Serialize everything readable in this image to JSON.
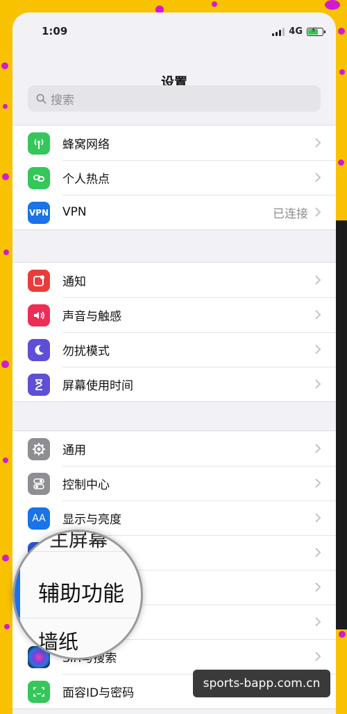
{
  "status_bar": {
    "time": "1:09",
    "network": "4G"
  },
  "header": {
    "title": "设置"
  },
  "search": {
    "placeholder": "搜索"
  },
  "group1": [
    {
      "label": "蜂窝网络",
      "icon": "antenna-icon",
      "color": "#34c759"
    },
    {
      "label": "个人热点",
      "icon": "hotspot-link-icon",
      "color": "#34c759"
    },
    {
      "label": "VPN",
      "icon_text": "VPN",
      "icon": "vpn-icon",
      "color": "#1a73e8",
      "value": "已连接"
    }
  ],
  "group2": [
    {
      "label": "通知",
      "icon": "notification-icon",
      "color": "#ec3b3b"
    },
    {
      "label": "声音与触感",
      "icon": "speaker-icon",
      "color": "#ec2e56"
    },
    {
      "label": "勿扰模式",
      "icon": "moon-icon",
      "color": "#5e4fd6"
    },
    {
      "label": "屏幕使用时间",
      "icon": "hourglass-icon",
      "color": "#5e4fd6"
    }
  ],
  "group3": [
    {
      "label": "通用",
      "icon": "gear-icon",
      "color": "#8e8e93"
    },
    {
      "label": "控制中心",
      "icon": "toggles-icon",
      "color": "#8e8e93"
    },
    {
      "label": "显示与亮度",
      "icon_text": "AA",
      "icon": "text-size-icon",
      "color": "#1a73e8"
    },
    {
      "label": "",
      "icon": "home-screen-grid-icon",
      "color": "#2f56d9"
    },
    {
      "label": "",
      "icon": "accessibility-icon",
      "color": "#1a73e8"
    },
    {
      "label": "",
      "icon": "wallpaper-icon",
      "color": "#33a7d8"
    },
    {
      "label": "Siri与搜索",
      "icon": "siri-icon",
      "color": "#1c1c2e"
    },
    {
      "label": "面容ID与密码",
      "icon": "face-id-icon",
      "color": "#34c759"
    }
  ],
  "magnifier": {
    "top_text": "主屏幕",
    "main_text": "辅助功能",
    "bottom_text": "墙纸"
  },
  "watermark": {
    "text": "sports-bapp.com.cn"
  }
}
